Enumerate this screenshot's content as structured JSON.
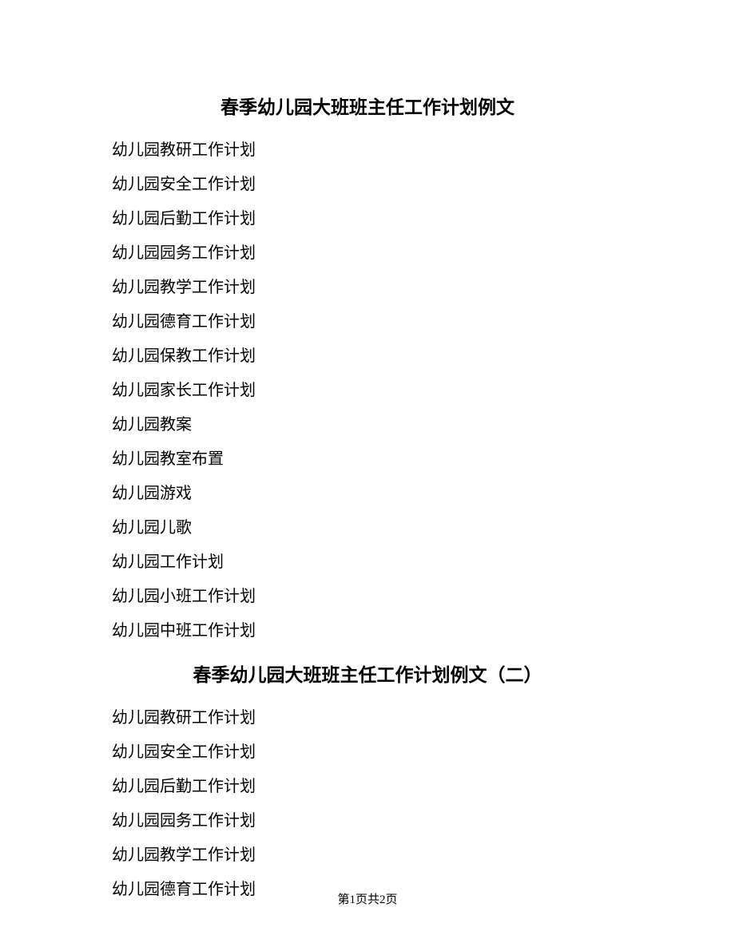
{
  "section1": {
    "title": "春季幼儿园大班班主任工作计划例文",
    "items": [
      "幼儿园教研工作计划",
      "幼儿园安全工作计划",
      "幼儿园后勤工作计划",
      "幼儿园园务工作计划",
      "幼儿园教学工作计划",
      "幼儿园德育工作计划",
      "幼儿园保教工作计划",
      "幼儿园家长工作计划",
      "幼儿园教案",
      "幼儿园教室布置",
      "幼儿园游戏",
      "幼儿园儿歌",
      "幼儿园工作计划",
      "幼儿园小班工作计划",
      "幼儿园中班工作计划"
    ]
  },
  "section2": {
    "title": "春季幼儿园大班班主任工作计划例文（二）",
    "items": [
      "幼儿园教研工作计划",
      "幼儿园安全工作计划",
      "幼儿园后勤工作计划",
      "幼儿园园务工作计划",
      "幼儿园教学工作计划",
      "幼儿园德育工作计划"
    ]
  },
  "footer": {
    "text": "第1页共2页"
  }
}
